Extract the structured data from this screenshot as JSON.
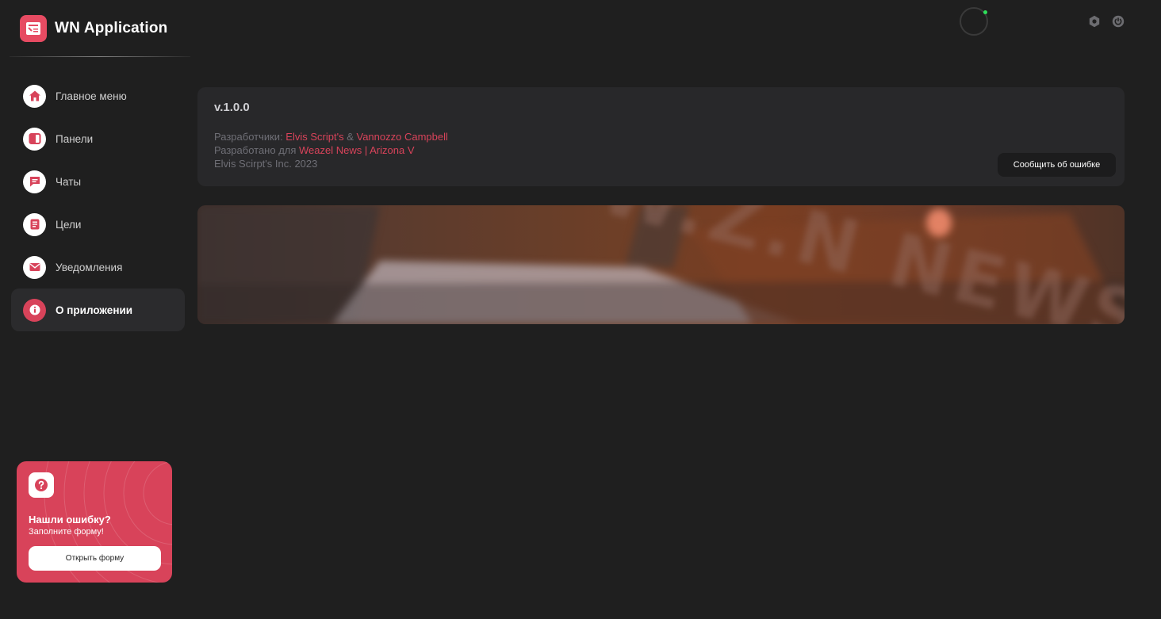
{
  "brand": {
    "title": "WN Application"
  },
  "sidebar": {
    "items": [
      {
        "label": "Главное меню",
        "icon": "home-icon",
        "active": false
      },
      {
        "label": "Панели",
        "icon": "panels-icon",
        "active": false
      },
      {
        "label": "Чаты",
        "icon": "chat-icon",
        "active": false
      },
      {
        "label": "Цели",
        "icon": "goals-icon",
        "active": false
      },
      {
        "label": "Уведомления",
        "icon": "mail-icon",
        "active": false
      },
      {
        "label": "О приложении",
        "icon": "info-icon",
        "active": true
      }
    ]
  },
  "help_card": {
    "title": "Нашли ошибку?",
    "subtitle": "Заполните форму!",
    "button": "Открыть форму"
  },
  "about": {
    "version": "v.1.0.0",
    "developers_prefix": "Разработчики: ",
    "developer_1": "Elvis Script's",
    "amp": " & ",
    "developer_2": "Vannozzo Campbell",
    "developed_for_prefix": "Разработано для ",
    "developed_for": "Weazel News | Arizona V",
    "copyright": "Elvis Scirpt's Inc. 2023",
    "report_button": "Сообщить об ошибке"
  },
  "colors": {
    "accent": "#d8435a",
    "background": "#1f1f1f",
    "card": "#28282a",
    "status_online": "#2ee05a"
  }
}
